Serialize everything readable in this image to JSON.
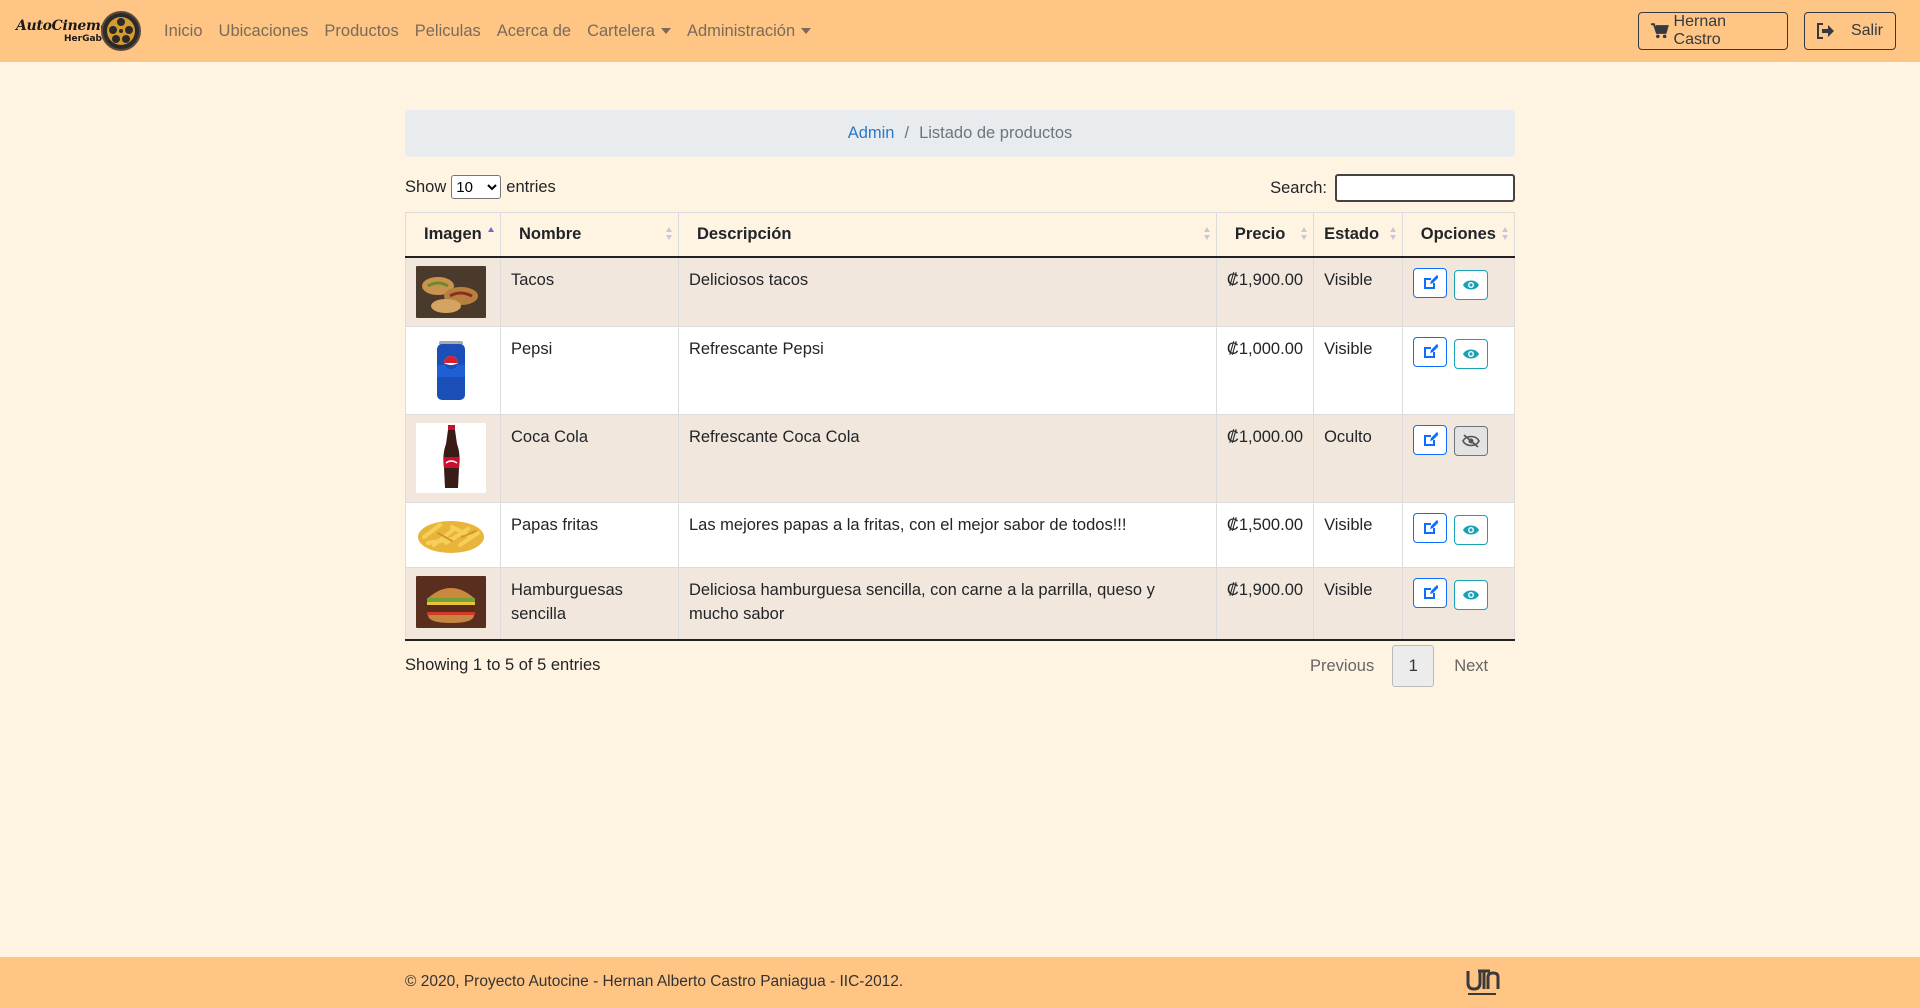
{
  "brand": {
    "line1": "AutoCinema",
    "line2": "HerGab"
  },
  "nav": {
    "items": [
      {
        "label": "Inicio"
      },
      {
        "label": "Ubicaciones"
      },
      {
        "label": "Productos"
      },
      {
        "label": "Peliculas"
      },
      {
        "label": "Acerca de"
      },
      {
        "label": "Cartelera"
      },
      {
        "label": "Administración"
      }
    ],
    "user_label": "Hernan Castro",
    "logout_label": "Salir"
  },
  "breadcrumb": {
    "root": "Admin",
    "separator": "/",
    "current": "Listado de productos"
  },
  "table_controls": {
    "show_label": "Show",
    "entries_label": "entries",
    "page_size": "10",
    "search_label": "Search:",
    "search_value": ""
  },
  "table": {
    "headers": [
      "Imagen",
      "Nombre",
      "Descripción",
      "Precio",
      "Estado",
      "Opciones"
    ],
    "rows": [
      {
        "nombre": "Tacos",
        "descripcion": "Deliciosos tacos",
        "precio": "₡1,900.00",
        "estado": "Visible",
        "image": "tacos-image",
        "visible": true
      },
      {
        "nombre": "Pepsi",
        "descripcion": "Refrescante Pepsi",
        "precio": "₡1,000.00",
        "estado": "Visible",
        "image": "pepsi-can-image",
        "visible": true
      },
      {
        "nombre": "Coca Cola",
        "descripcion": "Refrescante Coca Cola",
        "precio": "₡1,000.00",
        "estado": "Oculto",
        "image": "coca-cola-bottle-image",
        "visible": false
      },
      {
        "nombre": "Papas fritas",
        "descripcion": "Las mejores papas a la fritas, con el mejor sabor de todos!!!",
        "precio": "₡1,500.00",
        "estado": "Visible",
        "image": "fries-image",
        "visible": true
      },
      {
        "nombre": "Hamburguesas sencilla",
        "descripcion": "Deliciosa hamburguesa sencilla, con carne a la parrilla, queso y mucho sabor",
        "precio": "₡1,900.00",
        "estado": "Visible",
        "image": "burger-image",
        "visible": true
      }
    ]
  },
  "pagination": {
    "info": "Showing 1 to 5 of 5 entries",
    "previous": "Previous",
    "current_page": "1",
    "next": "Next"
  },
  "footer": {
    "text": "© 2020, Proyecto Autocine - Hernan Alberto Castro Paniagua - IIC-2012."
  },
  "colors": {
    "navbar": "#ffc585",
    "page_bg": "#fff3e2",
    "link": "#2a7ac7",
    "edit_btn": "#0d6efd",
    "view_btn": "#17a2b8"
  }
}
